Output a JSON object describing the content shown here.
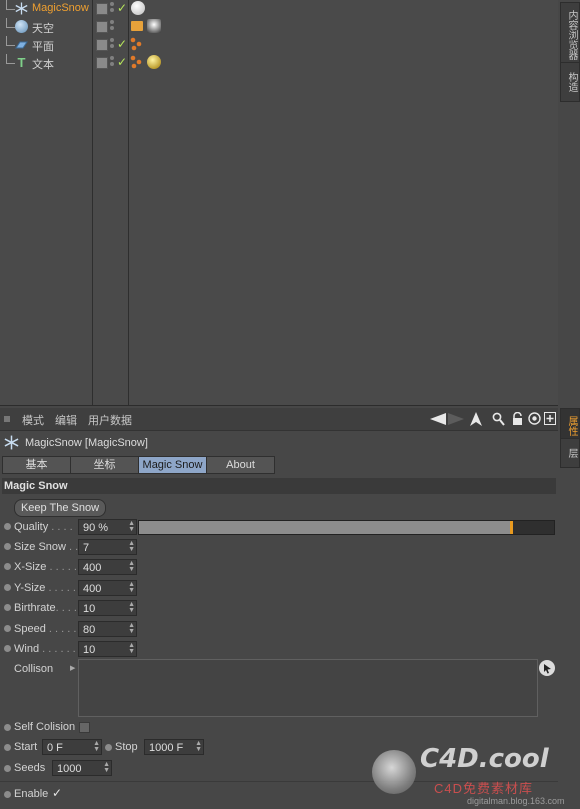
{
  "objects": [
    {
      "name": "MagicSnow",
      "icon": "snowflake-icon",
      "selected": true
    },
    {
      "name": "天空",
      "icon": "sky-sphere-icon",
      "selected": false
    },
    {
      "name": "平面",
      "icon": "plane-icon",
      "selected": false
    },
    {
      "name": "文本",
      "icon": "text-t-icon",
      "selected": false
    }
  ],
  "side_tabs_top": [
    "内容浏览器",
    "构造"
  ],
  "side_tabs_bottom": [
    "属性",
    "层"
  ],
  "menubar": {
    "mode": "模式",
    "edit": "编辑",
    "userdata": "用户数据"
  },
  "object_title": "MagicSnow [MagicSnow]",
  "tabs": [
    {
      "label": "基本",
      "active": false
    },
    {
      "label": "坐标",
      "active": false
    },
    {
      "label": "Magic Snow",
      "active": true
    },
    {
      "label": "About",
      "active": false
    }
  ],
  "section_title": "Magic Snow",
  "keep_button": "Keep The Snow",
  "params": [
    {
      "label": "Quality",
      "dots": " . . . .",
      "value": "90 %"
    },
    {
      "label": "Size Snow",
      "dots": " . .",
      "value": "7"
    },
    {
      "label": "X-Size",
      "dots": " . . . . .",
      "value": "400"
    },
    {
      "label": "Y-Size",
      "dots": " . . . . .",
      "value": "400"
    },
    {
      "label": "Birthrate",
      "dots": ". . . .",
      "value": "10"
    },
    {
      "label": "Speed",
      "dots": " . . . . .",
      "value": "80"
    },
    {
      "label": "Wind",
      "dots": " . . . . . .",
      "value": "10"
    }
  ],
  "quality_fraction": 0.9,
  "collision_label": "Collison",
  "self_collision_label": "Self Colision",
  "start": {
    "label": "Start",
    "value": "0 F"
  },
  "stop": {
    "label": "Stop",
    "value": "1000 F"
  },
  "seeds": {
    "label": "Seeds",
    "value": "1000"
  },
  "enable": {
    "label": "Enable",
    "check": "✓"
  },
  "watermark": {
    "logo": "C4D.cool",
    "sub": "C4D免费素材库",
    "url": "digitalman.blog.163.com"
  },
  "colors": {
    "accent": "#f0a030",
    "check": "#b6e55b",
    "tab_active": "#8ea6c8"
  }
}
